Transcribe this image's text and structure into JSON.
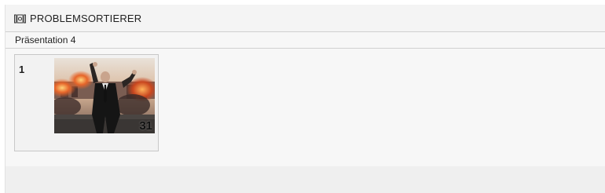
{
  "header": {
    "icon": "slide-sorter-icon",
    "title": "PROBLEMSORTIERER"
  },
  "presentation": {
    "title": "Präsentation 4"
  },
  "slides": [
    {
      "number": "1",
      "thumbnail": "explosion-scene-thumbnail",
      "badge": "31"
    }
  ]
}
